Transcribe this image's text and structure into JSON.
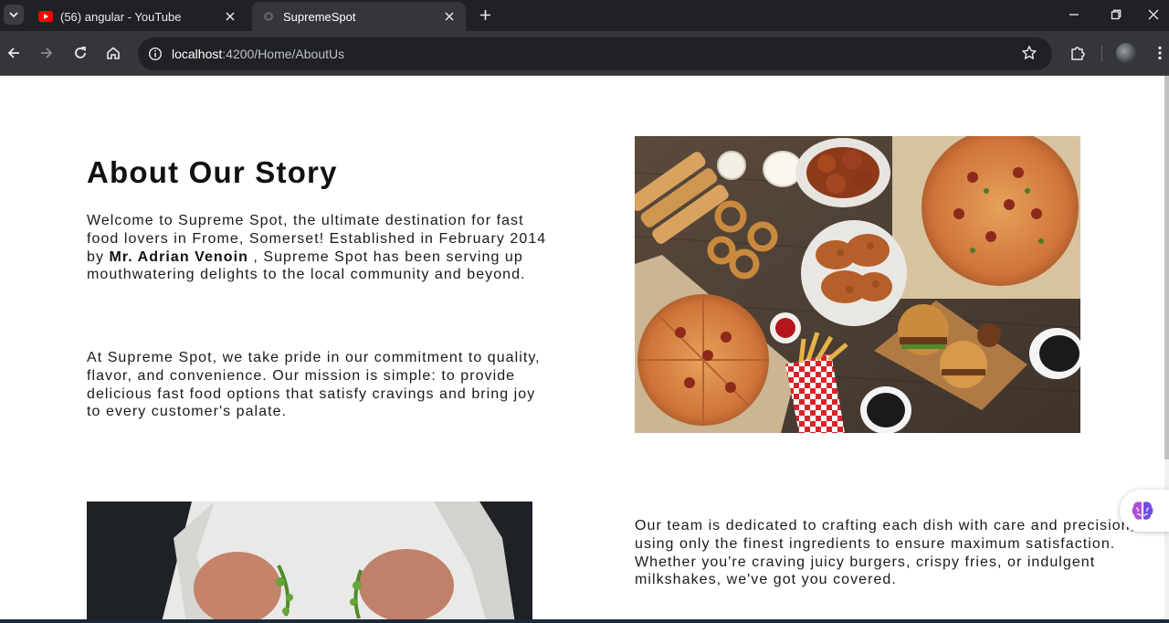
{
  "browser": {
    "tabs": [
      {
        "title": "(56) angular - YouTube",
        "favicon": "youtube-icon",
        "active": false
      },
      {
        "title": "SupremeSpot",
        "favicon": "site-icon",
        "active": true
      }
    ],
    "url_host": "localhost",
    "url_rest": ":4200/Home/AboutUs",
    "colors": {
      "chrome_dark": "#202124",
      "chrome_mid": "#35363a",
      "youtube_red": "#ff0000"
    }
  },
  "page": {
    "heading": "About Our Story",
    "intro": {
      "before_name": "Welcome to Supreme Spot, the ultimate destination for fast food lovers in Frome, Somerset! Established in February 2014 by ",
      "name": "Mr. Adrian Venoin",
      "after_name": " , Supreme Spot has been serving up mouthwatering delights to the local community and beyond."
    },
    "mission": "At Supreme Spot, we take pride in our commitment to quality, flavor, and convenience. Our mission is simple: to provide delicious fast food options that satisfy cravings and bring joy to every customer's palate.",
    "team": "Our team is dedicated to crafting each dish with care and precision, using only the finest ingredients to ensure maximum satisfaction. Whether you're craving juicy burgers, crispy fries, or indulgent milkshakes, we've got you covered.",
    "images": {
      "food": "fast-food-spread-photo",
      "chef": "chef-plating-photo"
    },
    "floating_button_icon": "brain-icon"
  }
}
